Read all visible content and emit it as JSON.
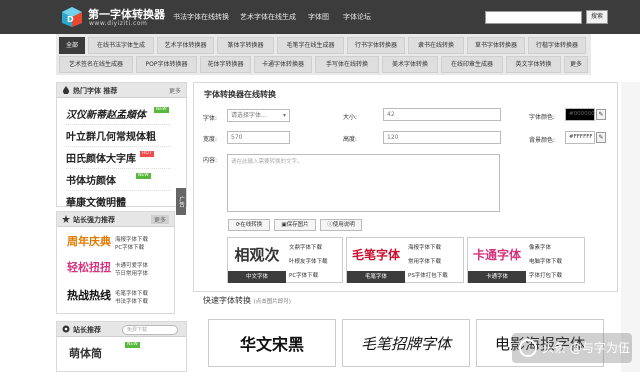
{
  "header": {
    "logo_title": "第一字体转换器",
    "logo_url": "www.diyiziti.com",
    "nav": [
      "书法字体在线转换",
      "艺术字体在线生成",
      "字体图",
      "字体论坛"
    ],
    "search_button": "搜索"
  },
  "categories": {
    "row1": [
      "全部",
      "在线书法字体生成",
      "艺术字体转换器",
      "篆体字转换器",
      "毛笔字在线生成器",
      "行书字体转换器",
      "隶书在线转换",
      "草书字体转换器",
      "行楷字体转换器"
    ],
    "row2": [
      "艺术签名在线生成器",
      "POP字体转换器",
      "花体字转换器",
      "卡通字体转换器",
      "手写体在线转换",
      "美术字体转换",
      "在线印章生成器",
      "英文字体转换",
      "更多"
    ]
  },
  "hot_fonts": {
    "title": "热门字体 推荐",
    "more": "更多",
    "items": [
      {
        "name": "汉仪新蒂赵孟頫体",
        "badge": "NEW"
      },
      {
        "name": "叶立群几何常规体粗",
        "badge": ""
      },
      {
        "name": "田氏颜体大字库",
        "badge": "HOT"
      },
      {
        "name": "书体坊颜体",
        "badge": "NEW"
      },
      {
        "name": "華康文徵明體",
        "badge": ""
      }
    ],
    "side_tab": "广告"
  },
  "promo": {
    "title": "站长强力推荐",
    "more": "更多",
    "items": [
      {
        "img": "周年庆典",
        "t1": "海报字体下载",
        "t2": "PC字体下载"
      },
      {
        "img": "轻松扭扭",
        "t1": "卡通可爱字体",
        "t2": "节日常用字体"
      },
      {
        "img": "热战热线",
        "t1": "毛笔字体下载",
        "t2": "书法字体下载"
      }
    ]
  },
  "webmaster": {
    "title": "站长推荐",
    "search_placeholder": "免费下载",
    "first_item": "萌体简",
    "badge": "NEW"
  },
  "converter": {
    "title": "字体转换器在线转换",
    "font_label": "字体:",
    "font_select": "请选择字体...",
    "size_label": "大小:",
    "size_value": "42",
    "font_color_label": "字体颜色:",
    "font_color_value": "#000000",
    "width_label": "宽度:",
    "width_value": "570",
    "height_label": "高度:",
    "height_value": "120",
    "bg_color_label": "背景颜色:",
    "bg_color_value": "#FFFFFF",
    "content_label": "内容:",
    "content_placeholder": "请在此输入需要转换的文字。",
    "btn_convert": "在线转换",
    "btn_save": "保存图片",
    "btn_help": "使用说明"
  },
  "tiles": [
    {
      "img": "相观次",
      "caption": "中文字体",
      "links": [
        "文鼎字体下载",
        "叶根友字体下载",
        "PC字体下载"
      ]
    },
    {
      "img": "毛笔字体",
      "caption": "毛笔字体",
      "links": [
        "海报字体下载",
        "常用字体下载",
        "PS字体打包下载"
      ]
    },
    {
      "img": "卡通字体",
      "caption": "卡通字体",
      "links": [
        "像素字体",
        "电脑字体下载",
        "字体打包下载"
      ]
    }
  ],
  "fast": {
    "title": "快速字体转换",
    "sub": "(点击图片即可)",
    "samples": [
      "华文宋黑",
      "毛笔招牌字体",
      "电影海报字体"
    ]
  },
  "watermark": "头条 @与字为伍",
  "colors": {
    "topbar": "#3c3c3c",
    "new_badge": "#58b83d",
    "hot_badge": "#ee4c4c"
  }
}
